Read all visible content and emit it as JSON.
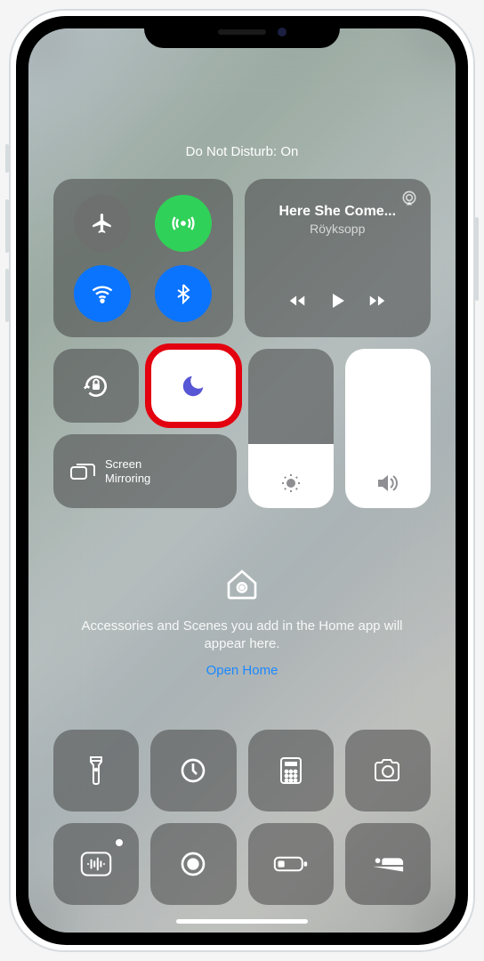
{
  "banner": "Do Not Disturb: On",
  "media": {
    "title": "Here She Come...",
    "artist": "Röyksopp"
  },
  "screenMirroring": "Screen\nMirroring",
  "home": {
    "msg": "Accessories and Scenes you add in the Home app will appear here.",
    "link": "Open Home"
  },
  "connectivity": {
    "airplane": "off",
    "cellular": "on",
    "wifi": "on",
    "bluetooth": "on"
  },
  "sliders": {
    "brightness_pct": 40,
    "volume_pct": 100
  }
}
